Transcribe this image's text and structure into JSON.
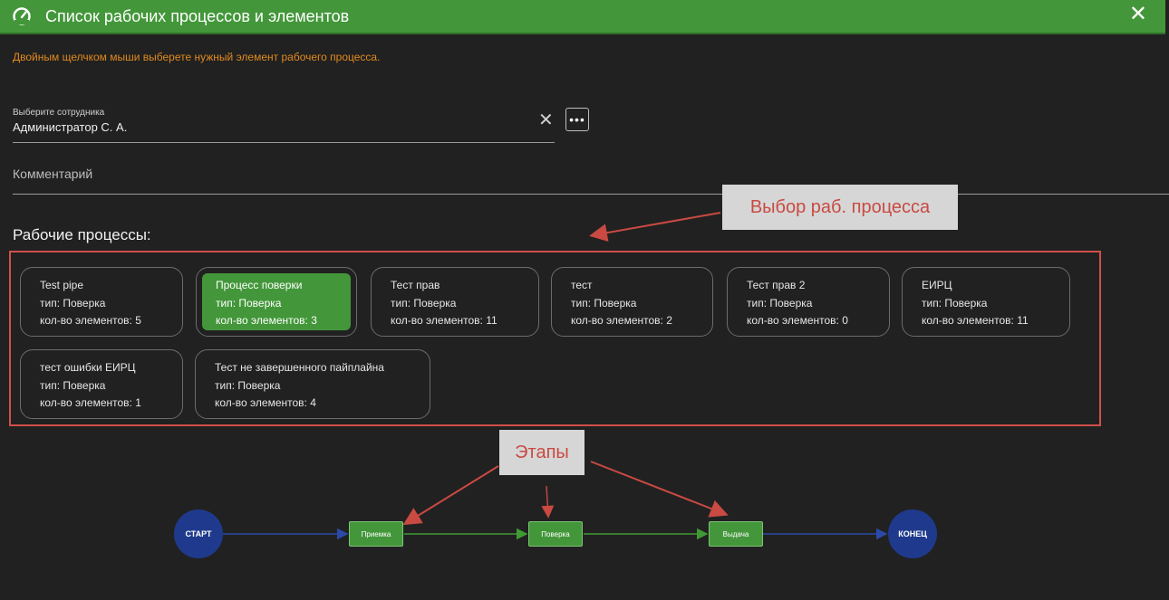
{
  "window": {
    "title": "Список рабочих процессов и элементов",
    "close_label": "✕"
  },
  "hint": "Двойным щелчком мыши выберете нужный элемент рабочего процесса.",
  "employee": {
    "label": "Выберите сотрудника",
    "value": "Администратор С. А.",
    "clear_label": "✕",
    "more_label": "•••"
  },
  "comment": {
    "label": "Комментарий"
  },
  "processes": {
    "title": "Рабочие процессы:",
    "items": [
      {
        "name": "Test pipe",
        "type": "тип: Поверка",
        "count": "кол-во элементов: 5"
      },
      {
        "name": "Процесс поверки",
        "type": "тип: Поверка",
        "count": "кол-во элементов: 3",
        "selected": true
      },
      {
        "name": "Тест прав",
        "type": "тип: Поверка",
        "count": "кол-во элементов: 11"
      },
      {
        "name": "тест",
        "type": "тип: Поверка",
        "count": "кол-во элементов: 2"
      },
      {
        "name": "Тест прав 2",
        "type": "тип: Поверка",
        "count": "кол-во элементов: 0"
      },
      {
        "name": "ЕИРЦ",
        "type": "тип: Поверка",
        "count": "кол-во элементов: 11"
      },
      {
        "name": "тест ошибки ЕИРЦ",
        "type": "тип: Поверка",
        "count": "кол-во элементов: 1"
      },
      {
        "name": "Тест не завершенного пайплайна",
        "type": "тип: Поверка",
        "count": "кол-во элементов: 4"
      }
    ]
  },
  "annotations": {
    "process_select": "Выбор  раб. процесса",
    "stages": "Этапы"
  },
  "pipeline": {
    "start": "СТАРТ",
    "stages": [
      "Приемка",
      "Поверка",
      "Выдача"
    ],
    "end": "КОНЕЦ"
  },
  "colors": {
    "accent_green": "#43973a",
    "node_blue": "#1f3a8c",
    "warning_orange": "#e08a1e",
    "annotation_red": "#d0504a"
  }
}
